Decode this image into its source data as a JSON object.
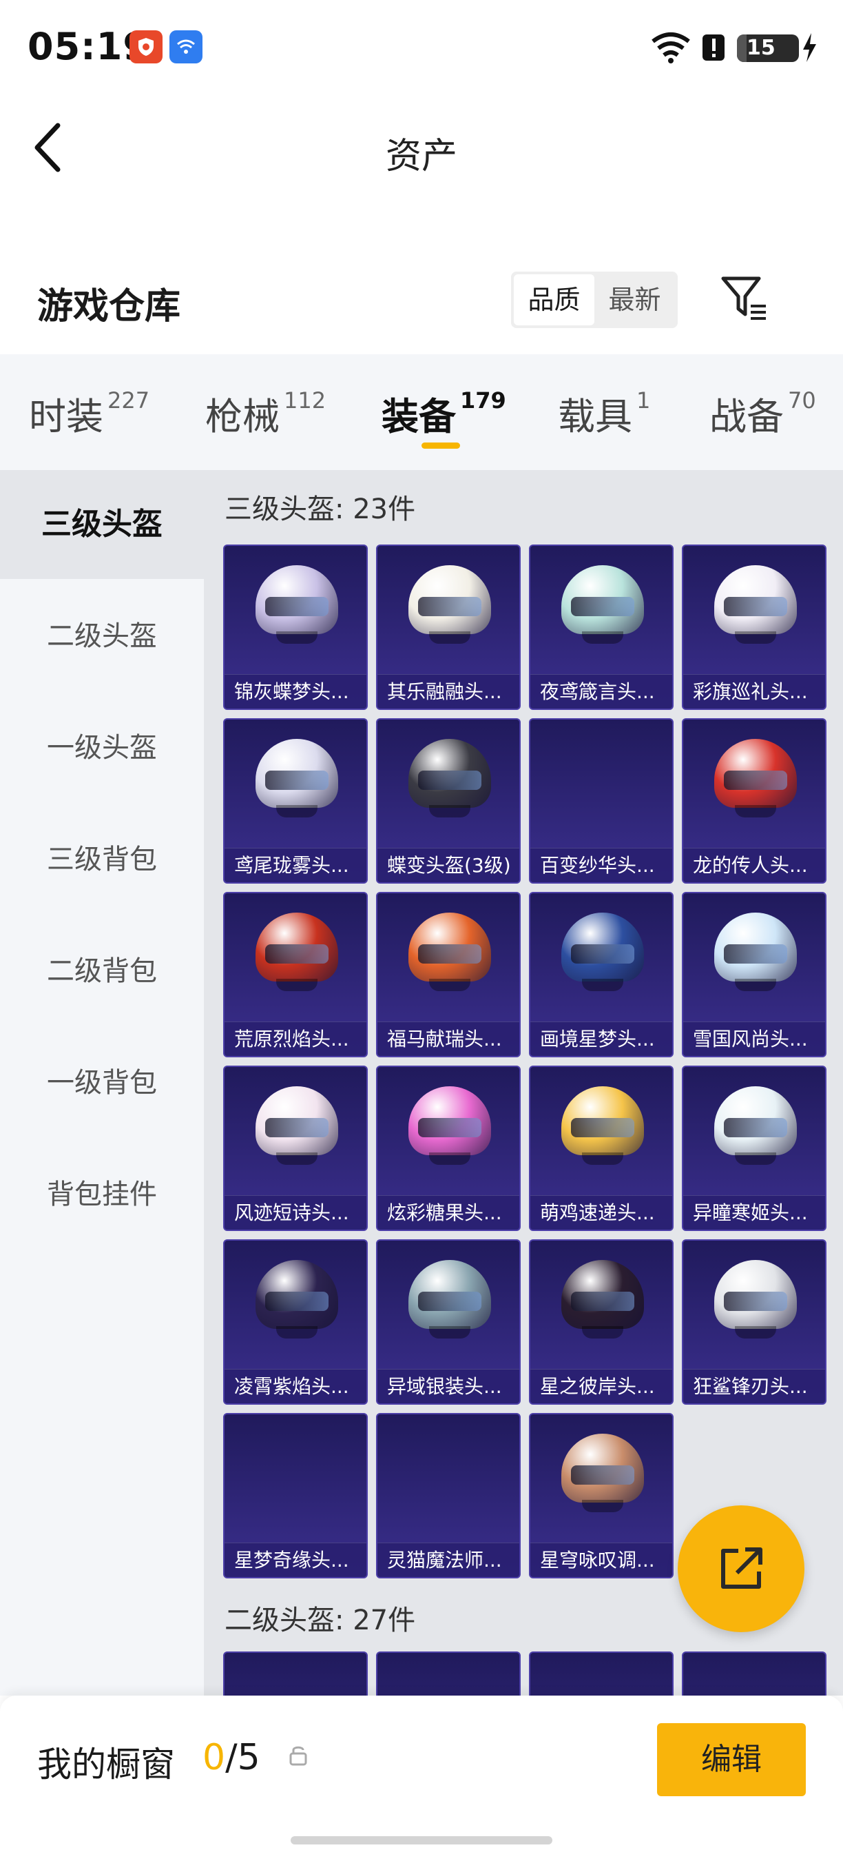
{
  "status_bar": {
    "time": "05:19",
    "battery": "15"
  },
  "header": {
    "title": "资产"
  },
  "warehouse": {
    "title": "游戏仓库",
    "sort_options": [
      "品质",
      "最新"
    ],
    "active_sort": "品质"
  },
  "tabs": [
    {
      "label": "时装",
      "count": "227"
    },
    {
      "label": "枪械",
      "count": "112"
    },
    {
      "label": "装备",
      "count": "179"
    },
    {
      "label": "载具",
      "count": "1"
    },
    {
      "label": "战备",
      "count": "70"
    }
  ],
  "active_tab": "装备",
  "side_nav": [
    "三级头盔",
    "二级头盔",
    "一级头盔",
    "三级背包",
    "二级背包",
    "一级背包",
    "背包挂件"
  ],
  "active_side": "三级头盔",
  "groups": [
    {
      "title": "三级头盔: 23件",
      "items": [
        {
          "name": "锦灰蝶梦头...",
          "color": "#c9c1e6"
        },
        {
          "name": "其乐融融头...",
          "color": "#f2efe6"
        },
        {
          "name": "夜鸢箴言头...",
          "color": "#b9e3dc"
        },
        {
          "name": "彩旗巡礼头...",
          "color": "#f1eef6"
        },
        {
          "name": "鸢尾珑雾头...",
          "color": "#dcdcee"
        },
        {
          "name": "蝶变头盔(3级)",
          "color": "#3b3b44"
        },
        {
          "name": "百变纱华头...",
          "color": ""
        },
        {
          "name": "龙的传人头...",
          "color": "#d8332b"
        },
        {
          "name": "荒原烈焰头...",
          "color": "#c8321f"
        },
        {
          "name": "福马献瑞头...",
          "color": "#e4642b"
        },
        {
          "name": "画境星梦头...",
          "color": "#2d4fa0"
        },
        {
          "name": "雪国风尚头...",
          "color": "#cfe6f8"
        },
        {
          "name": "风迹短诗头...",
          "color": "#f2e4ef"
        },
        {
          "name": "炫彩糖果头...",
          "color": "#e86ad0"
        },
        {
          "name": "萌鸡速递头...",
          "color": "#f5c44a"
        },
        {
          "name": "异瞳寒姬头...",
          "color": "#e8f2f6"
        },
        {
          "name": "凌霄紫焰头...",
          "color": "#2c2350"
        },
        {
          "name": "异域银装头...",
          "color": "#8aa5b0"
        },
        {
          "name": "星之彼岸头...",
          "color": "#2a1d30"
        },
        {
          "name": "狂鲨锋刃头...",
          "color": "#e2e4e8"
        },
        {
          "name": "星梦奇缘头...",
          "color": ""
        },
        {
          "name": "灵猫魔法师...",
          "color": ""
        },
        {
          "name": "星穹咏叹调...",
          "color": "#c98d6b"
        }
      ]
    },
    {
      "title": "二级头盔: 27件",
      "items": []
    }
  ],
  "showcase": {
    "label": "我的橱窗",
    "used": "0",
    "total": "/5"
  },
  "edit_label": "编辑"
}
